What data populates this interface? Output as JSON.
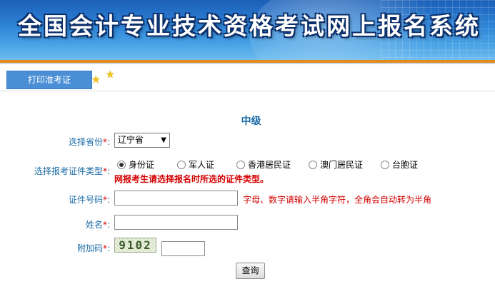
{
  "header": {
    "title": "全国会计专业技术资格考试网上报名系统"
  },
  "tab": {
    "label": "打印准考证"
  },
  "form": {
    "level": "中级",
    "province": {
      "label": "选择省份",
      "value": "辽宁省"
    },
    "id_type": {
      "label": "选择报考证件类型",
      "options": [
        "身份证",
        "军人证",
        "香港居民证",
        "澳门居民证",
        "台胞证"
      ],
      "selected": "身份证",
      "warning": "网报考生请选择报名时所选的证件类型。"
    },
    "id_number": {
      "label": "证件号码",
      "value": "",
      "hint": "字母、数字请输入半角字符，全角会自动转为半角"
    },
    "name": {
      "label": "姓名",
      "value": ""
    },
    "captcha": {
      "label": "附加码",
      "code": "9102",
      "value": ""
    },
    "required_mark": "*",
    "colon": ":",
    "submit_label": "查询"
  },
  "colors": {
    "accent": "#1a6aa6",
    "required": "#d40000",
    "tab": "#4a8fd6",
    "banner": "#2f86d8",
    "banner_stripe": "#e58b1c"
  }
}
